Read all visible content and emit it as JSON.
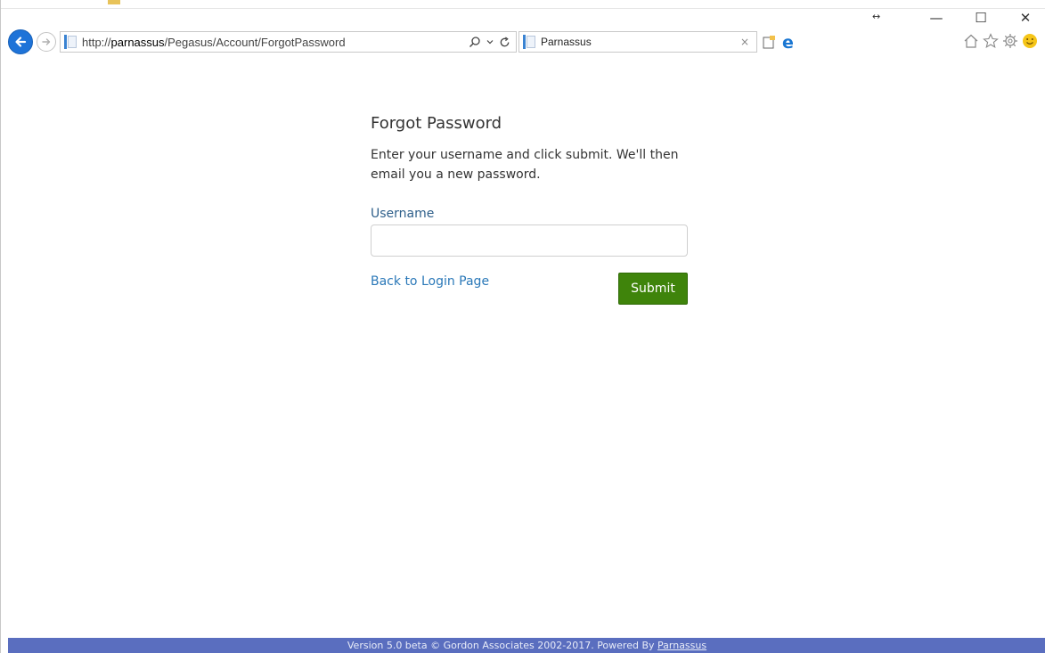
{
  "browser": {
    "address": {
      "prefix": "http://",
      "host": "parnassus",
      "path": "/Pegasus/Account/ForgotPassword"
    },
    "tab": {
      "title": "Parnassus",
      "close_glyph": "×"
    },
    "icons": {
      "back": "back-arrow-icon",
      "forward": "forward-arrow-icon",
      "search": "search-icon",
      "refresh": "refresh-icon",
      "home": "home-icon",
      "favorites": "star-icon",
      "settings": "gear-icon",
      "feedback": "smiley-icon"
    },
    "colors": {
      "back_button": "#1e73d8"
    }
  },
  "window": {
    "minimize": "—",
    "maximize": "☐",
    "close": "✕",
    "resize": "↔"
  },
  "form": {
    "title": "Forgot Password",
    "description": "Enter your username and click submit. We'll then email you a new password.",
    "username_label": "Username",
    "username_value": "",
    "back_link": "Back to Login Page",
    "submit_label": "Submit",
    "colors": {
      "submit": "#3f840b",
      "link": "#2a78b8",
      "label": "#2e5f8a"
    }
  },
  "footer": {
    "text": "Version 5.0 beta © Gordon Associates 2002-2017. Powered By ",
    "link": "Parnassus",
    "color": "#5a6ebf"
  }
}
